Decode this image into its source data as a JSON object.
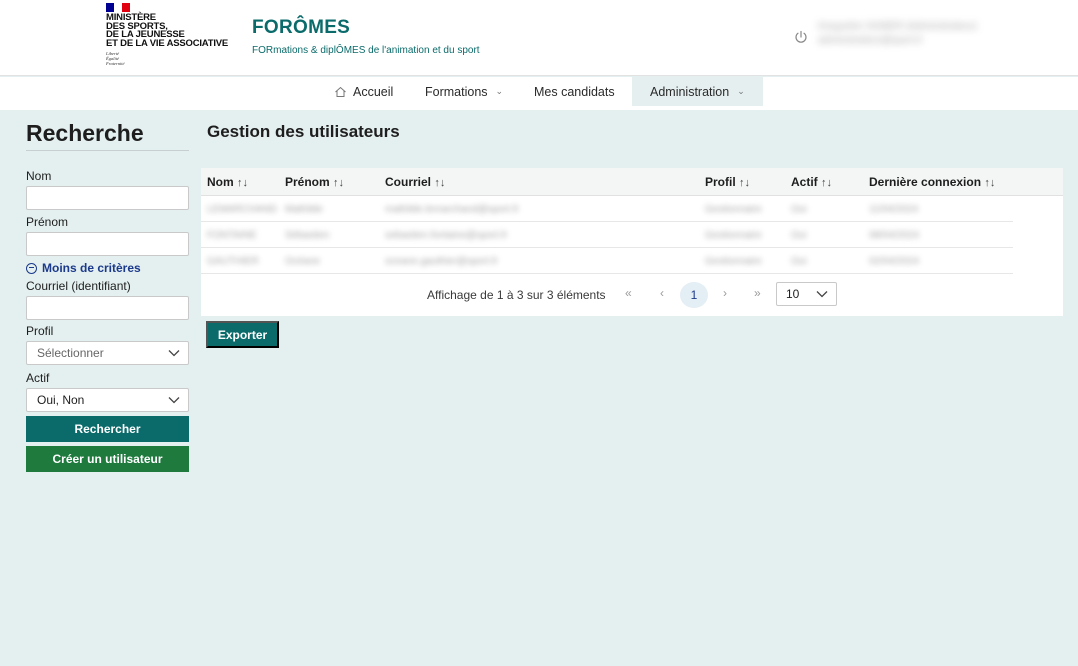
{
  "header": {
    "ministry_lines": [
      "Ministère",
      "des Sports,",
      "de la Jeunesse",
      "et de la Vie Associative"
    ],
    "motto_lines": [
      "Liberté",
      "Égalité",
      "Fraternité"
    ],
    "brand_name": "FORÔMES",
    "brand_tagline": "FORmations & diplÔMES de l'animation et du sport",
    "user_line1": "Kerguelen SOMER (Administrateur)",
    "user_line2": "administrateur@sport.fr",
    "flag_colors": [
      "#000091",
      "#ffffff",
      "#e1000f"
    ],
    "logout_icon": "power-icon"
  },
  "nav": {
    "items": [
      {
        "label": "Accueil",
        "icon": "home-icon"
      },
      {
        "label": "Formations",
        "icon": "chevron-down-icon"
      },
      {
        "label": "Mes candidats"
      },
      {
        "label": "Administration",
        "icon": "chevron-down-icon"
      }
    ]
  },
  "sidebar": {
    "title": "Recherche",
    "nom_label": "Nom",
    "nom_value": "",
    "prenom_label": "Prénom",
    "prenom_value": "",
    "criteria_toggle": "Moins de critères",
    "courriel_label": "Courriel (identifiant)",
    "courriel_value": "",
    "profil_label": "Profil",
    "profil_placeholder": "Sélectionner",
    "actif_label": "Actif",
    "actif_value": "Oui, Non",
    "search_button": "Rechercher",
    "create_button": "Créer un utilisateur"
  },
  "main": {
    "title": "Gestion des utilisateurs",
    "columns": [
      "Nom",
      "Prénom",
      "Courriel",
      "Profil",
      "Actif",
      "Dernière connexion"
    ],
    "sort_glyph": "↑↓",
    "rows": [
      [
        "LEMARCHAND",
        "Mathilde",
        "mathilde.lemarchand@sport.fr",
        "Gestionnaire",
        "Oui",
        "11/04/2024"
      ],
      [
        "FONTAINE",
        "Sébastien",
        "sebastien.fontaine@sport.fr",
        "Gestionnaire",
        "Oui",
        "08/04/2024"
      ],
      [
        "GAUTHIER",
        "Océane",
        "oceane.gauthier@sport.fr",
        "Gestionnaire",
        "Oui",
        "02/04/2024"
      ]
    ],
    "pager": {
      "summary": "Affichage de 1 à 3 sur 3 éléments",
      "first": "«",
      "prev": "‹",
      "current": "1",
      "next": "›",
      "last": "»",
      "page_size": "10"
    },
    "export_button": "Exporter"
  },
  "colors": {
    "primary": "#0b6b6b",
    "create": "#1f7a3e",
    "link": "#1b3a8c",
    "background": "#e4efef"
  }
}
